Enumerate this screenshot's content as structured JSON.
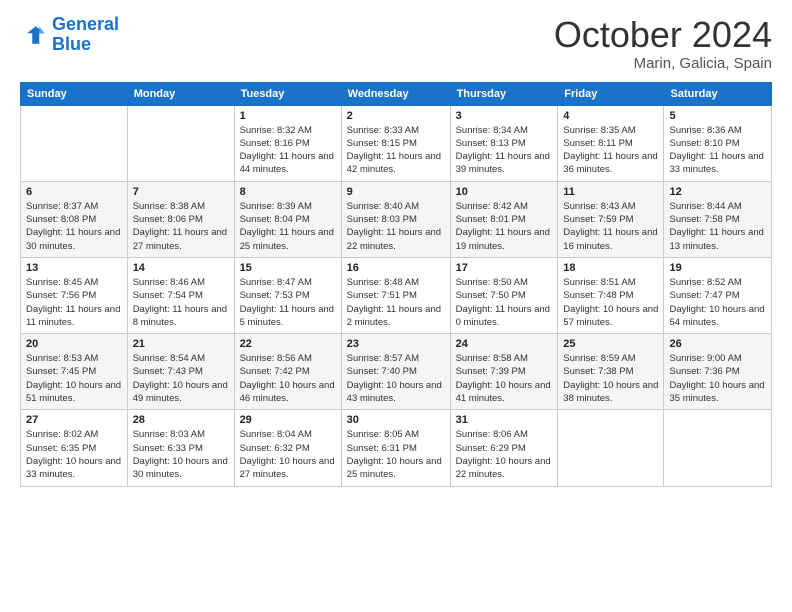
{
  "header": {
    "logo_line1": "General",
    "logo_line2": "Blue",
    "title": "October 2024",
    "subtitle": "Marin, Galicia, Spain"
  },
  "weekdays": [
    "Sunday",
    "Monday",
    "Tuesday",
    "Wednesday",
    "Thursday",
    "Friday",
    "Saturday"
  ],
  "weeks": [
    [
      {
        "day": "",
        "sunrise": "",
        "sunset": "",
        "daylight": ""
      },
      {
        "day": "",
        "sunrise": "",
        "sunset": "",
        "daylight": ""
      },
      {
        "day": "1",
        "sunrise": "Sunrise: 8:32 AM",
        "sunset": "Sunset: 8:16 PM",
        "daylight": "Daylight: 11 hours and 44 minutes."
      },
      {
        "day": "2",
        "sunrise": "Sunrise: 8:33 AM",
        "sunset": "Sunset: 8:15 PM",
        "daylight": "Daylight: 11 hours and 42 minutes."
      },
      {
        "day": "3",
        "sunrise": "Sunrise: 8:34 AM",
        "sunset": "Sunset: 8:13 PM",
        "daylight": "Daylight: 11 hours and 39 minutes."
      },
      {
        "day": "4",
        "sunrise": "Sunrise: 8:35 AM",
        "sunset": "Sunset: 8:11 PM",
        "daylight": "Daylight: 11 hours and 36 minutes."
      },
      {
        "day": "5",
        "sunrise": "Sunrise: 8:36 AM",
        "sunset": "Sunset: 8:10 PM",
        "daylight": "Daylight: 11 hours and 33 minutes."
      }
    ],
    [
      {
        "day": "6",
        "sunrise": "Sunrise: 8:37 AM",
        "sunset": "Sunset: 8:08 PM",
        "daylight": "Daylight: 11 hours and 30 minutes."
      },
      {
        "day": "7",
        "sunrise": "Sunrise: 8:38 AM",
        "sunset": "Sunset: 8:06 PM",
        "daylight": "Daylight: 11 hours and 27 minutes."
      },
      {
        "day": "8",
        "sunrise": "Sunrise: 8:39 AM",
        "sunset": "Sunset: 8:04 PM",
        "daylight": "Daylight: 11 hours and 25 minutes."
      },
      {
        "day": "9",
        "sunrise": "Sunrise: 8:40 AM",
        "sunset": "Sunset: 8:03 PM",
        "daylight": "Daylight: 11 hours and 22 minutes."
      },
      {
        "day": "10",
        "sunrise": "Sunrise: 8:42 AM",
        "sunset": "Sunset: 8:01 PM",
        "daylight": "Daylight: 11 hours and 19 minutes."
      },
      {
        "day": "11",
        "sunrise": "Sunrise: 8:43 AM",
        "sunset": "Sunset: 7:59 PM",
        "daylight": "Daylight: 11 hours and 16 minutes."
      },
      {
        "day": "12",
        "sunrise": "Sunrise: 8:44 AM",
        "sunset": "Sunset: 7:58 PM",
        "daylight": "Daylight: 11 hours and 13 minutes."
      }
    ],
    [
      {
        "day": "13",
        "sunrise": "Sunrise: 8:45 AM",
        "sunset": "Sunset: 7:56 PM",
        "daylight": "Daylight: 11 hours and 11 minutes."
      },
      {
        "day": "14",
        "sunrise": "Sunrise: 8:46 AM",
        "sunset": "Sunset: 7:54 PM",
        "daylight": "Daylight: 11 hours and 8 minutes."
      },
      {
        "day": "15",
        "sunrise": "Sunrise: 8:47 AM",
        "sunset": "Sunset: 7:53 PM",
        "daylight": "Daylight: 11 hours and 5 minutes."
      },
      {
        "day": "16",
        "sunrise": "Sunrise: 8:48 AM",
        "sunset": "Sunset: 7:51 PM",
        "daylight": "Daylight: 11 hours and 2 minutes."
      },
      {
        "day": "17",
        "sunrise": "Sunrise: 8:50 AM",
        "sunset": "Sunset: 7:50 PM",
        "daylight": "Daylight: 11 hours and 0 minutes."
      },
      {
        "day": "18",
        "sunrise": "Sunrise: 8:51 AM",
        "sunset": "Sunset: 7:48 PM",
        "daylight": "Daylight: 10 hours and 57 minutes."
      },
      {
        "day": "19",
        "sunrise": "Sunrise: 8:52 AM",
        "sunset": "Sunset: 7:47 PM",
        "daylight": "Daylight: 10 hours and 54 minutes."
      }
    ],
    [
      {
        "day": "20",
        "sunrise": "Sunrise: 8:53 AM",
        "sunset": "Sunset: 7:45 PM",
        "daylight": "Daylight: 10 hours and 51 minutes."
      },
      {
        "day": "21",
        "sunrise": "Sunrise: 8:54 AM",
        "sunset": "Sunset: 7:43 PM",
        "daylight": "Daylight: 10 hours and 49 minutes."
      },
      {
        "day": "22",
        "sunrise": "Sunrise: 8:56 AM",
        "sunset": "Sunset: 7:42 PM",
        "daylight": "Daylight: 10 hours and 46 minutes."
      },
      {
        "day": "23",
        "sunrise": "Sunrise: 8:57 AM",
        "sunset": "Sunset: 7:40 PM",
        "daylight": "Daylight: 10 hours and 43 minutes."
      },
      {
        "day": "24",
        "sunrise": "Sunrise: 8:58 AM",
        "sunset": "Sunset: 7:39 PM",
        "daylight": "Daylight: 10 hours and 41 minutes."
      },
      {
        "day": "25",
        "sunrise": "Sunrise: 8:59 AM",
        "sunset": "Sunset: 7:38 PM",
        "daylight": "Daylight: 10 hours and 38 minutes."
      },
      {
        "day": "26",
        "sunrise": "Sunrise: 9:00 AM",
        "sunset": "Sunset: 7:36 PM",
        "daylight": "Daylight: 10 hours and 35 minutes."
      }
    ],
    [
      {
        "day": "27",
        "sunrise": "Sunrise: 8:02 AM",
        "sunset": "Sunset: 6:35 PM",
        "daylight": "Daylight: 10 hours and 33 minutes."
      },
      {
        "day": "28",
        "sunrise": "Sunrise: 8:03 AM",
        "sunset": "Sunset: 6:33 PM",
        "daylight": "Daylight: 10 hours and 30 minutes."
      },
      {
        "day": "29",
        "sunrise": "Sunrise: 8:04 AM",
        "sunset": "Sunset: 6:32 PM",
        "daylight": "Daylight: 10 hours and 27 minutes."
      },
      {
        "day": "30",
        "sunrise": "Sunrise: 8:05 AM",
        "sunset": "Sunset: 6:31 PM",
        "daylight": "Daylight: 10 hours and 25 minutes."
      },
      {
        "day": "31",
        "sunrise": "Sunrise: 8:06 AM",
        "sunset": "Sunset: 6:29 PM",
        "daylight": "Daylight: 10 hours and 22 minutes."
      },
      {
        "day": "",
        "sunrise": "",
        "sunset": "",
        "daylight": ""
      },
      {
        "day": "",
        "sunrise": "",
        "sunset": "",
        "daylight": ""
      }
    ]
  ]
}
